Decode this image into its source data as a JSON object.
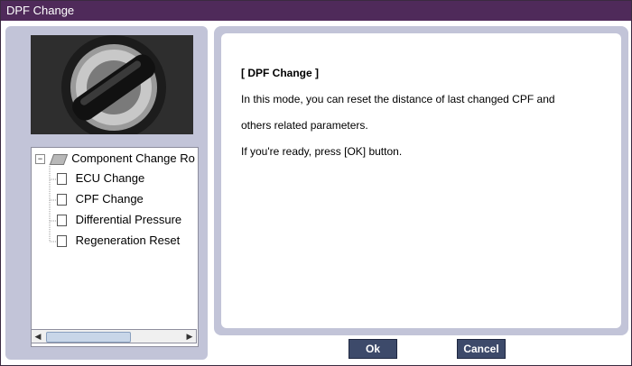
{
  "window": {
    "title": "DPF Change"
  },
  "tree": {
    "root_label": "Component Change Ro",
    "items": [
      {
        "label": "ECU Change"
      },
      {
        "label": "CPF Change"
      },
      {
        "label": "Differential Pressure"
      },
      {
        "label": "Regeneration Reset"
      }
    ]
  },
  "message": {
    "heading": "[ DPF Change ]",
    "line1": "In this mode, you can reset the distance of last changed CPF and",
    "line2": "others related parameters.",
    "line3": "If you're ready, press [OK] button."
  },
  "buttons": {
    "ok_label": "Ok",
    "cancel_label": "Cancel"
  },
  "colors": {
    "titlebar": "#4f2a5a",
    "panel": "#c2c4d8",
    "button": "#3d4a6a"
  }
}
